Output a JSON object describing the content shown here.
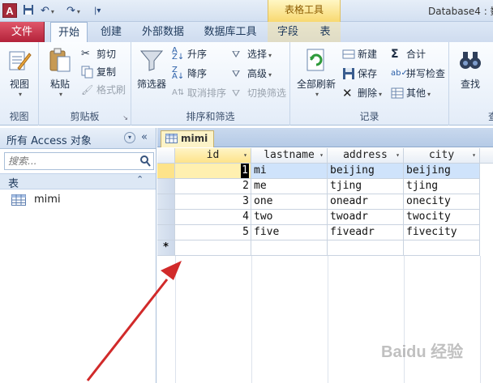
{
  "title_bar": {
    "app_icon_letter": "A",
    "quick_access": [
      "save-icon",
      "undo-icon",
      "redo-icon",
      "customize-icon"
    ],
    "context_group_label": "表格工具",
    "window_title": "Database4 : 数"
  },
  "ribbon_tabs": [
    "文件",
    "开始",
    "创建",
    "外部数据",
    "数据库工具",
    "字段",
    "表"
  ],
  "ribbon": {
    "views": {
      "view_label": "视图",
      "group": "视图"
    },
    "clipboard": {
      "paste": "粘贴",
      "cut": "剪切",
      "copy": "复制",
      "format_painter": "格式刷",
      "group": "剪贴板"
    },
    "sort_filter": {
      "filter": "筛选器",
      "ascending": "升序",
      "descending": "降序",
      "clear_sort": "取消排序",
      "selection": "选择",
      "advanced": "高级",
      "toggle_filter": "切换筛选",
      "group": "排序和筛选"
    },
    "records": {
      "refresh_all": "全部刷新",
      "new": "新建",
      "save": "保存",
      "delete": "删除",
      "totals": "合计",
      "spelling": "拼写检查",
      "more": "其他",
      "group": "记录"
    },
    "find": {
      "find_label": "查找",
      "group_partial": "查"
    }
  },
  "nav_pane": {
    "header": "所有 Access 对象",
    "search_placeholder": "搜索...",
    "category": "表",
    "items": [
      "mimi"
    ]
  },
  "document": {
    "tab_label": "mimi",
    "columns": [
      "id",
      "lastname",
      "address",
      "city"
    ],
    "rows": [
      {
        "id": "1",
        "lastname": "mi",
        "address": "beijing",
        "city": "beijing"
      },
      {
        "id": "2",
        "lastname": "me",
        "address": "tjing",
        "city": "tjing"
      },
      {
        "id": "3",
        "lastname": "one",
        "address": "oneadr",
        "city": "onecity"
      },
      {
        "id": "4",
        "lastname": "two",
        "address": "twoadr",
        "city": "twocity"
      },
      {
        "id": "5",
        "lastname": "five",
        "address": "fiveadr",
        "city": "fivecity"
      }
    ],
    "new_record_marker": "*"
  },
  "watermark": "Baidu 经验",
  "colors": {
    "file_tab": "#b3233a",
    "selection": "#fde38a",
    "arrow": "#d12a2a"
  }
}
